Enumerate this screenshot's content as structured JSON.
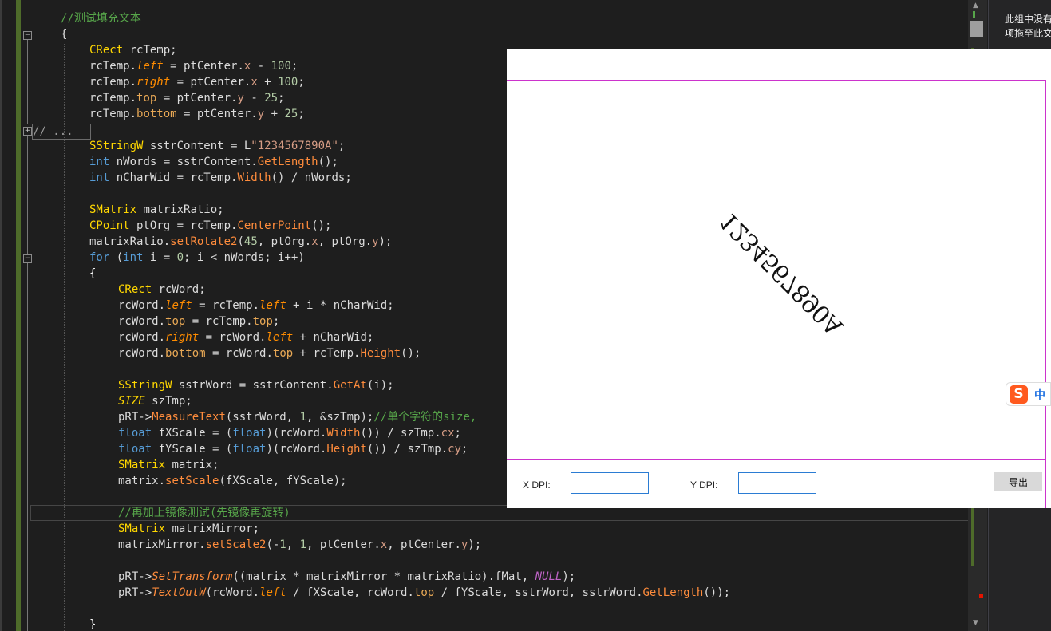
{
  "editor": {
    "lines": [
      [
        [
          "t-com",
          "//测试填充文本"
        ]
      ],
      [
        [
          "",
          "{"
        ]
      ],
      [
        [
          "t-type",
          "CRect"
        ],
        [
          "",
          " rcTemp;"
        ]
      ],
      [
        [
          "",
          "rcTemp."
        ],
        [
          "t-memi",
          "left"
        ],
        [
          "",
          " = ptCenter."
        ],
        [
          "t-mem",
          "x"
        ],
        [
          "",
          " - "
        ],
        [
          "t-num",
          "100"
        ],
        [
          "",
          ";"
        ]
      ],
      [
        [
          "",
          "rcTemp."
        ],
        [
          "t-memi",
          "right"
        ],
        [
          "",
          " = ptCenter."
        ],
        [
          "t-mem",
          "x"
        ],
        [
          "",
          " + "
        ],
        [
          "t-num",
          "100"
        ],
        [
          "",
          ";"
        ]
      ],
      [
        [
          "",
          "rcTemp."
        ],
        [
          "t-memb",
          "top"
        ],
        [
          "",
          " = ptCenter."
        ],
        [
          "t-mem",
          "y"
        ],
        [
          "",
          " - "
        ],
        [
          "t-num",
          "25"
        ],
        [
          "",
          ";"
        ]
      ],
      [
        [
          "",
          "rcTemp."
        ],
        [
          "t-memb",
          "bottom"
        ],
        [
          "",
          " = ptCenter."
        ],
        [
          "t-mem",
          "y"
        ],
        [
          "",
          " + "
        ],
        [
          "t-num",
          "25"
        ],
        [
          "",
          ";"
        ]
      ],
      [],
      [
        [
          "t-type",
          "SStringW"
        ],
        [
          "",
          " sstrContent = L"
        ],
        [
          "t-str",
          "\"1234567890A\""
        ],
        [
          "",
          ";"
        ]
      ],
      [
        [
          "t-kw",
          "int"
        ],
        [
          "",
          " nWords = sstrContent."
        ],
        [
          "t-fn",
          "GetLength"
        ],
        [
          "",
          "();"
        ]
      ],
      [
        [
          "t-kw",
          "int"
        ],
        [
          "",
          " nCharWid = rcTemp."
        ],
        [
          "t-fn",
          "Width"
        ],
        [
          "",
          "() / nWords;"
        ]
      ],
      [],
      [
        [
          "t-type",
          "SMatrix"
        ],
        [
          "",
          " matrixRatio;"
        ]
      ],
      [
        [
          "t-type",
          "CPoint"
        ],
        [
          "",
          " ptOrg = rcTemp."
        ],
        [
          "t-fn",
          "CenterPoint"
        ],
        [
          "",
          "();"
        ]
      ],
      [
        [
          "",
          "matrixRatio."
        ],
        [
          "t-fn",
          "setRotate2"
        ],
        [
          "",
          "("
        ],
        [
          "t-num",
          "45"
        ],
        [
          "",
          ", ptOrg."
        ],
        [
          "t-mem",
          "x"
        ],
        [
          "",
          ", ptOrg."
        ],
        [
          "t-mem",
          "y"
        ],
        [
          "",
          ");"
        ]
      ],
      [
        [
          "t-kw",
          "for"
        ],
        [
          "",
          " ("
        ],
        [
          "t-kw",
          "int"
        ],
        [
          "",
          " i = "
        ],
        [
          "t-num",
          "0"
        ],
        [
          "",
          "; i < nWords; i++)"
        ]
      ],
      [
        [
          "t-brace",
          "{"
        ]
      ],
      [
        [
          "t-type",
          "CRect"
        ],
        [
          "",
          " rcWord;"
        ]
      ],
      [
        [
          "",
          "rcWord."
        ],
        [
          "t-memi",
          "left"
        ],
        [
          "",
          " = rcTemp."
        ],
        [
          "t-memi",
          "left"
        ],
        [
          "",
          " + i * nCharWid;"
        ]
      ],
      [
        [
          "",
          "rcWord."
        ],
        [
          "t-memb",
          "top"
        ],
        [
          "",
          " = rcTemp."
        ],
        [
          "t-memb",
          "top"
        ],
        [
          "",
          ";"
        ]
      ],
      [
        [
          "",
          "rcWord."
        ],
        [
          "t-memi",
          "right"
        ],
        [
          "",
          " = rcWord."
        ],
        [
          "t-memi",
          "left"
        ],
        [
          "",
          " + nCharWid;"
        ]
      ],
      [
        [
          "",
          "rcWord."
        ],
        [
          "t-memb",
          "bottom"
        ],
        [
          "",
          " = rcWord."
        ],
        [
          "t-memb",
          "top"
        ],
        [
          "",
          " + rcTemp."
        ],
        [
          "t-fn",
          "Height"
        ],
        [
          "",
          "();"
        ]
      ],
      [],
      [
        [
          "t-type",
          "SStringW"
        ],
        [
          "",
          " sstrWord = sstrContent."
        ],
        [
          "t-fn",
          "GetAt"
        ],
        [
          "",
          "(i);"
        ]
      ],
      [
        [
          "t-sizei",
          "SIZE"
        ],
        [
          "",
          " szTmp;"
        ]
      ],
      [
        [
          "",
          "pRT->"
        ],
        [
          "t-fn",
          "MeasureText"
        ],
        [
          "",
          "(sstrWord, "
        ],
        [
          "t-num",
          "1"
        ],
        [
          "",
          ", &szTmp);"
        ],
        [
          "t-com",
          "//单个字符的size,"
        ]
      ],
      [
        [
          "t-kw",
          "float"
        ],
        [
          "",
          " fXScale = ("
        ],
        [
          "t-kw",
          "float"
        ],
        [
          "",
          ")(rcWord."
        ],
        [
          "t-fn",
          "Width"
        ],
        [
          "",
          "()) / szTmp."
        ],
        [
          "t-mem",
          "cx"
        ],
        [
          "",
          ";"
        ]
      ],
      [
        [
          "t-kw",
          "float"
        ],
        [
          "",
          " fYScale = ("
        ],
        [
          "t-kw",
          "float"
        ],
        [
          "",
          ")(rcWord."
        ],
        [
          "t-fn",
          "Height"
        ],
        [
          "",
          "()) / szTmp."
        ],
        [
          "t-mem",
          "cy"
        ],
        [
          "",
          ";"
        ]
      ],
      [
        [
          "t-type",
          "SMatrix"
        ],
        [
          "",
          " matrix;"
        ]
      ],
      [
        [
          "",
          "matrix."
        ],
        [
          "t-fn",
          "setScale"
        ],
        [
          "",
          "(fXScale, fYScale);"
        ]
      ],
      [],
      [
        [
          "t-com",
          "//再加上镜像测试(先镜像再旋转)"
        ]
      ],
      [
        [
          "t-type",
          "SMatrix"
        ],
        [
          "",
          " matrixMirror;"
        ]
      ],
      [
        [
          "",
          "matrixMirror."
        ],
        [
          "t-fn",
          "setScale2"
        ],
        [
          "",
          "(-"
        ],
        [
          "t-num",
          "1"
        ],
        [
          "",
          ", "
        ],
        [
          "t-num",
          "1"
        ],
        [
          "",
          ", ptCenter."
        ],
        [
          "t-mem",
          "x"
        ],
        [
          "",
          ", ptCenter."
        ],
        [
          "t-mem",
          "y"
        ],
        [
          "",
          ");"
        ]
      ],
      [],
      [
        [
          "",
          "pRT->"
        ],
        [
          "t-fni",
          "SetTransform"
        ],
        [
          "",
          "((matrix * matrixMirror * matrixRatio).fMat, "
        ],
        [
          "t-macro",
          "NULL"
        ],
        [
          "",
          ");"
        ]
      ],
      [
        [
          "",
          "pRT->"
        ],
        [
          "t-fni",
          "TextOutW"
        ],
        [
          "",
          "(rcWord."
        ],
        [
          "t-memi",
          "left"
        ],
        [
          "",
          " / fXScale, rcWord."
        ],
        [
          "t-memb",
          "top"
        ],
        [
          "",
          " / fYScale, sstrWord, sstrWord."
        ],
        [
          "t-fn",
          "GetLength"
        ],
        [
          "",
          "());"
        ]
      ],
      [],
      [
        [
          "t-brace",
          "}"
        ]
      ]
    ],
    "collapsed_label": "// ...",
    "fold_collapsed_glyph": "+",
    "fold_expanded_glyph": "−"
  },
  "right_panel": {
    "message": "此组中没有\n项拖至此文"
  },
  "preview_dialog": {
    "rendered_text": "1234567890A",
    "x_dpi_label": "X DPI:",
    "x_dpi_value": "",
    "y_dpi_label": "Y DPI:",
    "y_dpi_value": "",
    "export_label": "导出"
  },
  "ime": {
    "logo": "S",
    "lang": "中"
  },
  "colors": {
    "accent_border": "#cc33cc",
    "input_border": "#2b7cd3",
    "editor_bg": "#1e1e1e"
  }
}
